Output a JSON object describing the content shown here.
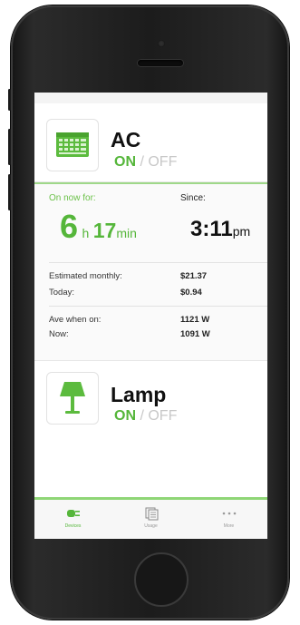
{
  "devices": [
    {
      "name": "AC",
      "state_on": "ON",
      "state_sep": "/",
      "state_off": "OFF"
    },
    {
      "name": "Lamp",
      "state_on": "ON",
      "state_sep": "/",
      "state_off": "OFF"
    }
  ],
  "detail": {
    "on_now_for_label": "On now for:",
    "since_label": "Since:",
    "duration_hours": "6",
    "duration_hours_unit": "h",
    "duration_minutes": "17",
    "duration_minutes_unit": "min",
    "since_time": "3:11",
    "since_ampm": "pm",
    "estimated_monthly_label": "Estimated monthly:",
    "estimated_monthly_value": "$21.37",
    "today_label": "Today:",
    "today_value": "$0.94",
    "ave_when_on_label": "Ave when on:",
    "ave_when_on_value": "1121 W",
    "now_label": "Now:",
    "now_value": "1091 W"
  },
  "tabs": [
    {
      "label": "Devices",
      "icon": "plug-icon",
      "active": true
    },
    {
      "label": "Usage",
      "icon": "calendar-icon",
      "active": false
    },
    {
      "label": "More",
      "icon": "more-dots-icon",
      "active": false
    }
  ],
  "colors": {
    "accent": "#55b63a",
    "accent_light": "#8fd676"
  }
}
